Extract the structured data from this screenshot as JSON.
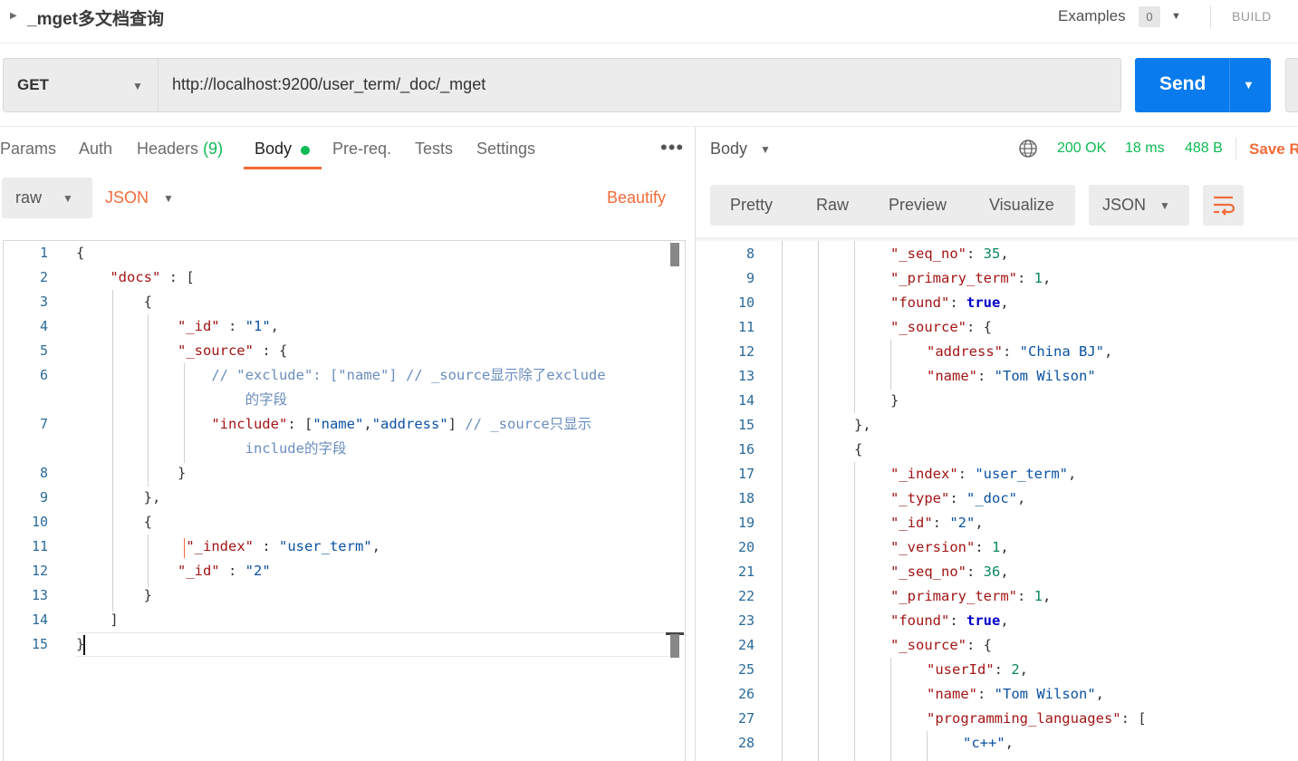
{
  "header": {
    "title": "_mget多文档查询",
    "examples_label": "Examples",
    "examples_count": "0",
    "build_label": "BUILD"
  },
  "request": {
    "method": "GET",
    "url": "http://localhost:9200/user_term/_doc/_mget",
    "send_label": "Send"
  },
  "tabs": {
    "params": "Params",
    "auth": "Auth",
    "headers": "Headers",
    "headers_count": "(9)",
    "body": "Body",
    "prereq": "Pre-req.",
    "tests": "Tests",
    "settings": "Settings",
    "more": "•••"
  },
  "body_toolbar": {
    "mode": "raw",
    "format": "JSON",
    "beautify": "Beautify"
  },
  "editor": {
    "line_numbers": [
      "1",
      "2",
      "3",
      "4",
      "5",
      "6",
      "7",
      "8",
      "9",
      "10",
      "11",
      "12",
      "13",
      "14",
      "15"
    ]
  },
  "response": {
    "body_label": "Body",
    "status": "200 OK",
    "time": "18 ms",
    "size": "488 B",
    "save_label": "Save R",
    "view_tabs": [
      "Pretty",
      "Raw",
      "Preview",
      "Visualize"
    ],
    "format": "JSON",
    "line_numbers": [
      "8",
      "9",
      "10",
      "11",
      "12",
      "13",
      "14",
      "15",
      "16",
      "17",
      "18",
      "19",
      "20",
      "21",
      "22",
      "23",
      "24",
      "25",
      "26",
      "27",
      "28"
    ]
  },
  "colors": {
    "accent_orange": "#f26b3a",
    "send_blue": "#097bed",
    "status_green": "#0cbb52"
  }
}
